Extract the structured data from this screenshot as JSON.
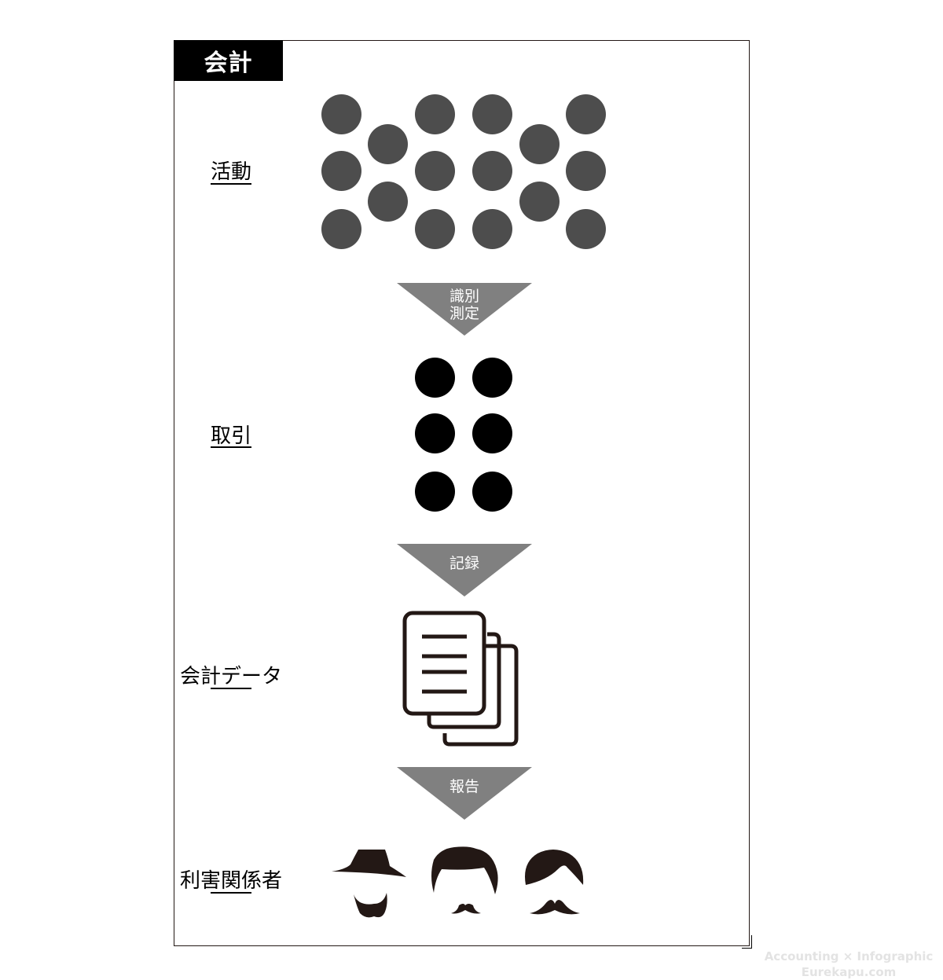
{
  "title": "会計",
  "stages": [
    {
      "label": "活動",
      "icon": "activity-dots-icon"
    },
    {
      "label": "取引",
      "icon": "transaction-dots-icon"
    },
    {
      "label": "会計データ",
      "icon": "documents-icon"
    },
    {
      "label": "利害関係者",
      "icon": "stakeholders-icon"
    }
  ],
  "arrows": [
    {
      "line1": "識別",
      "line2": "測定"
    },
    {
      "line1": "記録"
    },
    {
      "line1": "報告"
    }
  ],
  "colors": {
    "activity_dot": "#4d4d4d",
    "transaction_dot": "#000000",
    "arrow_fill": "#808080",
    "ink": "#231815"
  },
  "watermark": {
    "line1": "Accounting × Infographic",
    "line2": "Eurekapu.com"
  }
}
